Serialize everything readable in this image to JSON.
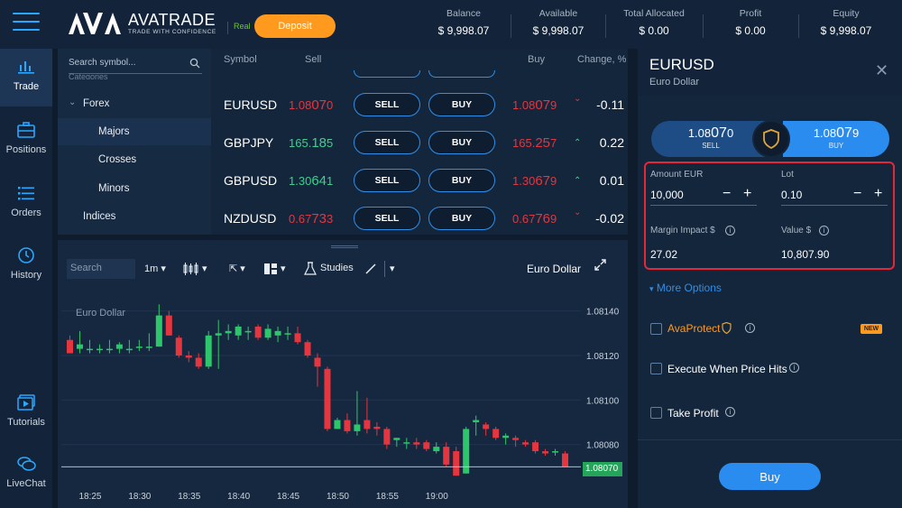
{
  "brand": {
    "name": "AVATRADE",
    "tagline": "TRADE WITH CONFIDENCE",
    "account_mode": "Real",
    "deposit_label": "Deposit"
  },
  "account": [
    {
      "label": "Balance",
      "value": "$ 9,998.07"
    },
    {
      "label": "Available",
      "value": "$ 9,998.07"
    },
    {
      "label": "Total Allocated",
      "value": "$ 0.00"
    },
    {
      "label": "Profit",
      "value": "$ 0.00"
    },
    {
      "label": "Equity",
      "value": "$ 9,998.07"
    }
  ],
  "sidebar": {
    "items": [
      {
        "label": "Trade",
        "icon": "chart-bars-icon"
      },
      {
        "label": "Positions",
        "icon": "briefcase-icon"
      },
      {
        "label": "Orders",
        "icon": "list-icon"
      },
      {
        "label": "History",
        "icon": "history-icon"
      },
      {
        "label": "Tutorials",
        "icon": "video-icon"
      },
      {
        "label": "LiveChat",
        "icon": "chat-icon"
      }
    ]
  },
  "symbols": {
    "search_placeholder": "Search symbol...",
    "categories_label": "Categories",
    "tree": [
      "Forex",
      "Majors",
      "Crosses",
      "Minors",
      "Indices"
    ]
  },
  "quotes": {
    "headers": {
      "symbol": "Symbol",
      "sell": "Sell",
      "buy": "Buy",
      "change": "Change, %"
    },
    "sell_label": "SELL",
    "buy_label": "BUY",
    "rows": [
      {
        "pair": "EURUSD",
        "sell_pre": "1.08",
        "sell_big": "07",
        "sell_post": "0",
        "sell_color": "red",
        "buy_pre": "1.08",
        "buy_big": "07",
        "buy_post": "9",
        "arrow": "⌄",
        "dir": "down",
        "change": "-0.11"
      },
      {
        "pair": "GBPJPY",
        "sell_pre": "165.",
        "sell_big": "18",
        "sell_post": "5",
        "sell_color": "green",
        "buy_pre": "165.",
        "buy_big": "25",
        "buy_post": "7",
        "arrow": "⌃",
        "dir": "up",
        "change": "0.22"
      },
      {
        "pair": "GBPUSD",
        "sell_pre": "1.30",
        "sell_big": "64",
        "sell_post": "1",
        "sell_color": "green",
        "buy_pre": "1.30",
        "buy_big": "67",
        "buy_post": "9",
        "arrow": "⌃",
        "dir": "up",
        "change": "0.01"
      },
      {
        "pair": "NZDUSD",
        "sell_pre": "0.67",
        "sell_big": "73",
        "sell_post": "3",
        "sell_color": "red",
        "buy_pre": "0.67",
        "buy_big": "76",
        "buy_post": "9",
        "arrow": "⌄",
        "dir": "down",
        "change": "-0.02"
      }
    ]
  },
  "chart_toolbar": {
    "search_placeholder": "Search",
    "interval": "1m",
    "studies_label": "Studies",
    "title": "Euro Dollar"
  },
  "chart_data": {
    "type": "candlestick",
    "legend": "Euro Dollar",
    "ylim": [
      1.0806,
      1.0815
    ],
    "y_ticks": [
      "1.08140",
      "1.08120",
      "1.08100",
      "1.08080"
    ],
    "x_ticks": [
      "18:25",
      "18:30",
      "18:35",
      "18:40",
      "18:45",
      "18:50",
      "18:55",
      "19:00"
    ],
    "last_price": "1.08070",
    "candles": [
      [
        1.08127,
        1.08121,
        1.08129,
        1.08121
      ],
      [
        1.08123,
        1.08125,
        1.08131,
        1.08121
      ],
      [
        1.08123,
        1.08123,
        1.08127,
        1.08121
      ],
      [
        1.08123,
        1.08123,
        1.08125,
        1.08121
      ],
      [
        1.08123,
        1.08123,
        1.08127,
        1.08121
      ],
      [
        1.08123,
        1.08125,
        1.08126,
        1.08121
      ],
      [
        1.08123,
        1.08123,
        1.08127,
        1.08121
      ],
      [
        1.08124,
        1.08124,
        1.08127,
        1.08122
      ],
      [
        1.08124,
        1.08124,
        1.0813,
        1.08122
      ],
      [
        1.08124,
        1.08138,
        1.08143,
        1.08124
      ],
      [
        1.08138,
        1.08129,
        1.0814,
        1.08129
      ],
      [
        1.08128,
        1.0812,
        1.08129,
        1.08119
      ],
      [
        1.0812,
        1.08119,
        1.08122,
        1.08117
      ],
      [
        1.08119,
        1.08115,
        1.08121,
        1.08114
      ],
      [
        1.08115,
        1.08129,
        1.08131,
        1.08114
      ],
      [
        1.08129,
        1.0813,
        1.08136,
        1.08114
      ],
      [
        1.0813,
        1.08131,
        1.08134,
        1.08127
      ],
      [
        1.08129,
        1.08133,
        1.08134,
        1.08127
      ],
      [
        1.08131,
        1.08131,
        1.08133,
        1.08127
      ],
      [
        1.08133,
        1.08128,
        1.08134,
        1.08127
      ],
      [
        1.08128,
        1.08132,
        1.08134,
        1.08127
      ],
      [
        1.08129,
        1.08131,
        1.08133,
        1.08126
      ],
      [
        1.0813,
        1.0813,
        1.08133,
        1.08127
      ],
      [
        1.0813,
        1.08126,
        1.08133,
        1.08125
      ],
      [
        1.08126,
        1.0812,
        1.08127,
        1.08119
      ],
      [
        1.08119,
        1.08115,
        1.08121,
        1.08106
      ],
      [
        1.08114,
        1.08087,
        1.08115,
        1.08086
      ],
      [
        1.08087,
        1.08091,
        1.08092,
        1.08087
      ],
      [
        1.08091,
        1.08086,
        1.08094,
        1.08085
      ],
      [
        1.08086,
        1.08089,
        1.08104,
        1.08084
      ],
      [
        1.08091,
        1.08087,
        1.08101,
        1.08085
      ],
      [
        1.08088,
        1.08087,
        1.0809,
        1.08084
      ],
      [
        1.08087,
        1.0808,
        1.08088,
        1.08078
      ],
      [
        1.08082,
        1.08083,
        1.08083,
        1.08079
      ],
      [
        1.08081,
        1.08081,
        1.08083,
        1.08078
      ],
      [
        1.08081,
        1.0808,
        1.08083,
        1.08078
      ],
      [
        1.08081,
        1.08078,
        1.08082,
        1.08077
      ],
      [
        1.08077,
        1.08079,
        1.08081,
        1.08076
      ],
      [
        1.08079,
        1.08071,
        1.08081,
        1.0807
      ],
      [
        1.08077,
        1.08066,
        1.08079,
        1.08066
      ],
      [
        1.08067,
        1.08087,
        1.08088,
        1.08067
      ],
      [
        1.0809,
        1.08091,
        1.08093,
        1.08084
      ],
      [
        1.08089,
        1.08087,
        1.0809,
        1.08084
      ],
      [
        1.08087,
        1.08083,
        1.08088,
        1.08082
      ],
      [
        1.08083,
        1.08084,
        1.08085,
        1.0808
      ],
      [
        1.08083,
        1.08082,
        1.08084,
        1.08079
      ],
      [
        1.08081,
        1.0808,
        1.08082,
        1.08079
      ],
      [
        1.08081,
        1.08077,
        1.08082,
        1.08076
      ],
      [
        1.08077,
        1.08076,
        1.08078,
        1.08075
      ],
      [
        1.08077,
        1.08077,
        1.08078,
        1.08075
      ],
      [
        1.08076,
        1.0807,
        1.08077,
        1.0807
      ]
    ]
  },
  "order": {
    "symbol": "EURUSD",
    "description": "Euro Dollar",
    "sell": {
      "pre": "1.08",
      "big": "07",
      "post": "0",
      "label": "SELL"
    },
    "buy": {
      "pre": "1.08",
      "big": "07",
      "post": "9",
      "label": "BUY"
    },
    "amount_label": "Amount EUR",
    "amount_value": "10,000",
    "lot_label": "Lot",
    "lot_value": "0.10",
    "margin_label": "Margin Impact $",
    "margin_value": "27.02",
    "value_label": "Value $",
    "value_value": "10,807.90",
    "more_options": "More Options",
    "options": [
      "AvaProtect",
      "Execute When Price Hits",
      "Take Profit"
    ],
    "new_badge": "NEW",
    "buy_button": "Buy",
    "colors": {
      "sell": "#1e4d86",
      "buy": "#2b8cf0",
      "highlight_border": "#e52738",
      "accent": "#ff9a1f"
    }
  }
}
